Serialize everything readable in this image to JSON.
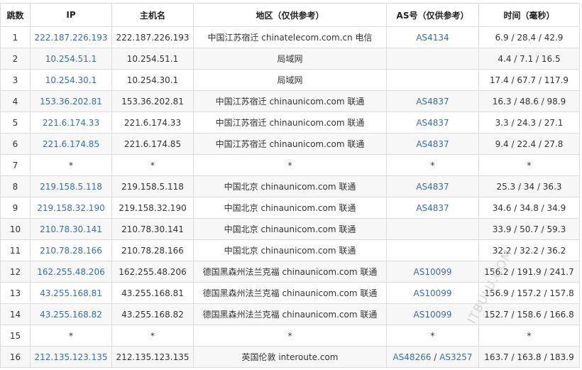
{
  "headers": {
    "hop": "跳数",
    "ip": "IP",
    "host": "主机名",
    "region": "地区（仅供参考）",
    "as": "AS号（仅供参考）",
    "time": "时间（毫秒）"
  },
  "rows": [
    {
      "hop": "1",
      "ip": "222.187.226.193",
      "host": "222.187.226.193",
      "region": "中国江苏宿迁 chinatelecom.com.cn 电信",
      "as": "AS4134",
      "as2": "",
      "time": "6.9 / 28.4 / 42.9"
    },
    {
      "hop": "2",
      "ip": "10.254.51.1",
      "host": "10.254.51.1",
      "region": "局域网",
      "as": "",
      "as2": "",
      "time": "4.4 / 7.1 / 16.5"
    },
    {
      "hop": "3",
      "ip": "10.254.30.1",
      "host": "10.254.30.1",
      "region": "局域网",
      "as": "",
      "as2": "",
      "time": "17.4 / 67.7 / 117.9"
    },
    {
      "hop": "4",
      "ip": "153.36.202.81",
      "host": "153.36.202.81",
      "region": "中国江苏宿迁 chinaunicom.com 联通",
      "as": "AS4837",
      "as2": "",
      "time": "16.3 / 48.6 / 98.9"
    },
    {
      "hop": "5",
      "ip": "221.6.174.33",
      "host": "221.6.174.33",
      "region": "中国江苏宿迁 chinaunicom.com 联通",
      "as": "AS4837",
      "as2": "",
      "time": "3.3 / 24.3 / 27.1"
    },
    {
      "hop": "6",
      "ip": "221.6.174.85",
      "host": "221.6.174.85",
      "region": "中国江苏宿迁 chinaunicom.com 联通",
      "as": "AS4837",
      "as2": "",
      "time": "9.4 / 22.4 / 27.8"
    },
    {
      "hop": "7",
      "ip": "*",
      "host": "*",
      "region": "*",
      "as": "*",
      "as2": "",
      "time": "*"
    },
    {
      "hop": "8",
      "ip": "219.158.5.118",
      "host": "219.158.5.118",
      "region": "中国北京 chinaunicom.com 联通",
      "as": "AS4837",
      "as2": "",
      "time": "25.3 / 34 / 36.3"
    },
    {
      "hop": "9",
      "ip": "219.158.32.190",
      "host": "219.158.32.190",
      "region": "中国北京 chinaunicom.com 联通",
      "as": "AS4837",
      "as2": "",
      "time": "34.6 / 34.8 / 34.9"
    },
    {
      "hop": "10",
      "ip": "210.78.30.141",
      "host": "210.78.30.141",
      "region": "中国北京 chinaunicom.com 联通",
      "as": "",
      "as2": "",
      "time": "33.9 / 50.7 / 59.3"
    },
    {
      "hop": "11",
      "ip": "210.78.28.166",
      "host": "210.78.28.166",
      "region": "中国北京 chinaunicom.com 联通",
      "as": "",
      "as2": "",
      "time": "32.2 / 32.2 / 36.2"
    },
    {
      "hop": "12",
      "ip": "162.255.48.206",
      "host": "162.255.48.206",
      "region": "德国黑森州法兰克福 chinaunicom.com 联通",
      "as": "AS10099",
      "as2": "",
      "time": "156.2 / 191.9 / 241.7"
    },
    {
      "hop": "13",
      "ip": "43.255.168.81",
      "host": "43.255.168.81",
      "region": "德国黑森州法兰克福 chinaunicom.com 联通",
      "as": "AS10099",
      "as2": "",
      "time": "156.9 / 157.2 / 157.8"
    },
    {
      "hop": "14",
      "ip": "43.255.168.82",
      "host": "43.255.168.82",
      "region": "德国黑森州法兰克福 chinaunicom.com 联通",
      "as": "AS10099",
      "as2": "",
      "time": "152.7 / 158.6 / 166.8"
    },
    {
      "hop": "15",
      "ip": "*",
      "host": "*",
      "region": "*",
      "as": "*",
      "as2": "",
      "time": "*"
    },
    {
      "hop": "16",
      "ip": "212.135.123.135",
      "host": "212.135.123.135",
      "region": "英国伦敦 interoute.com",
      "as": "AS48266",
      "as2": "AS3257",
      "time": "163.7 / 163.8 / 183.9"
    }
  ],
  "as_separator": " / ",
  "watermark": "ITBULU.COM",
  "colors": {
    "link": "#3a6ea5",
    "border": "#dcdcdc",
    "stripe": "#f7f7f7"
  }
}
